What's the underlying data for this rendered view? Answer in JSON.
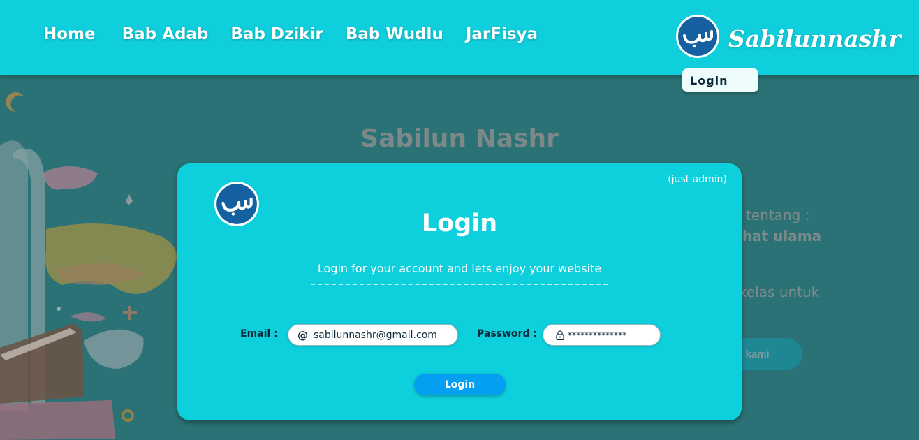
{
  "nav": {
    "links": [
      "Home",
      "Bab Adab",
      "Bab Dzikir",
      "Bab Wudlu",
      "JarFisya"
    ],
    "brand_name": "Sabilunnashr",
    "login_label": "Login"
  },
  "background_page": {
    "title": "Sabilun Nashr",
    "text_line_1": "tentang :",
    "text_line_2": "ihat ulama",
    "text_line_3": "kelas untuk",
    "cta_label": "m kami"
  },
  "modal": {
    "note": "(just admin)",
    "title": "Login",
    "subtitle": "Login for your account and lets enjoy your website",
    "email_label": "Email :",
    "email_value": "sabilunnashr@gmail.com",
    "password_label": "Password :",
    "password_value": "**************",
    "submit_label": "Login"
  },
  "icons": {
    "logo": "logo-icon",
    "email": "at-icon",
    "password": "lock-icon"
  },
  "colors": {
    "navbar": "#10cfdc",
    "modal": "#0ecfdc",
    "overlay_background": "#2a7275",
    "login_button": "#049ff0",
    "logo": "#1560a0"
  }
}
